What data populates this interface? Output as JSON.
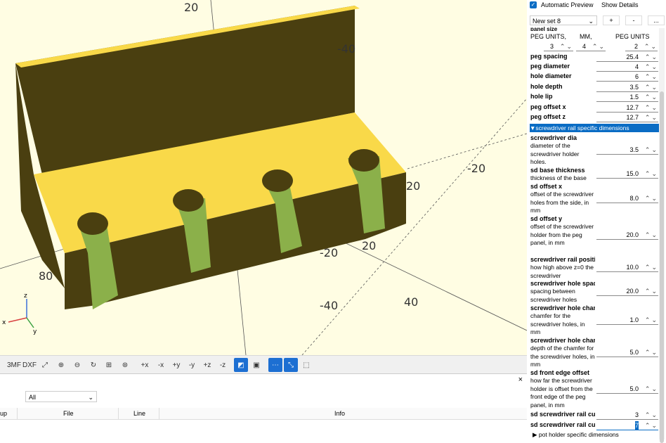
{
  "viewport": {
    "axis_labels": [
      "20",
      "-40",
      "-20",
      "20",
      "80",
      "40",
      "-40",
      "-20",
      "80"
    ],
    "gizmo": {
      "z": "z",
      "x": "x",
      "y": "y"
    }
  },
  "toolbar": {
    "buttons": [
      "3MF",
      "DXF",
      "⤢",
      "⊕",
      "⊖",
      "↻",
      "⊞",
      "⊛",
      "+x",
      "-x",
      "+y",
      "-y",
      "+z",
      "-z",
      "◩",
      "▣",
      "⋯",
      "⤡",
      "⬚"
    ]
  },
  "console": {
    "close": "×",
    "filter": "All",
    "columns": [
      "up",
      "File",
      "Line",
      "Info"
    ]
  },
  "panel": {
    "auto_preview": "Automatic Preview",
    "show_details": "Show Details",
    "preset": "New set 8",
    "plus": "+",
    "minus": "-",
    "more": "...",
    "panel_size_label": "panel size",
    "units": [
      "PEG UNITS,",
      "MM,",
      "PEG UNITS"
    ],
    "units_values": [
      "3",
      "4",
      "2"
    ],
    "params": [
      {
        "label": "peg spacing",
        "value": "25.4"
      },
      {
        "label": "peg diameter",
        "value": "4"
      },
      {
        "label": "hole diameter",
        "value": "6"
      },
      {
        "label": "hole depth",
        "value": "3.5"
      },
      {
        "label": "hole lip",
        "value": "1.5"
      },
      {
        "label": "peg offset x",
        "value": "12.7"
      },
      {
        "label": "peg offset z",
        "value": "12.7"
      }
    ],
    "section1": "screwdriver rail specific dimensions",
    "details": [
      {
        "label": "screwdriver dia",
        "desc": "diameter of the screwdriver holder holes.",
        "value": "3.5"
      },
      {
        "label": "sd base thickness",
        "desc": "thickness of the base",
        "value": "15.0"
      },
      {
        "label": "sd offset x",
        "desc": "offset of the screwdriver holes from the side, in mm",
        "value": "8.0"
      },
      {
        "label": "sd offset y",
        "desc": "offset of the screwdriver holder from the peg panel, in mm",
        "value": "20.0"
      },
      {
        "label": "screwdriver rail positio",
        "desc": "how high above z=0 the screwdriver",
        "value": "10.0"
      },
      {
        "label": "screwdriver hole spaci",
        "desc": "spacing between screwdriver holes",
        "value": "20.0"
      },
      {
        "label": "screwdriver hole cham",
        "desc": "chamfer for the screwdriver holes, in mm",
        "value": "1.0"
      },
      {
        "label": "screwdriver hole cham",
        "desc": "depth of the chamfer for the screwdriver holes, in mm",
        "value": "5.0"
      },
      {
        "label": "sd front edge offset",
        "desc": "how far the screwdriver holder is offset from the front edge of the peg panel, in mm",
        "value": "5.0"
      },
      {
        "label": "sd screwdriver rail cut",
        "desc": "",
        "value": "3"
      },
      {
        "label": "sd screwdriver rail cut",
        "desc": "",
        "value": "7"
      }
    ],
    "section2": "pot holder specific dimensions"
  },
  "colors": {
    "model_top": "#f9d949",
    "model_side": "#4a3f10",
    "hole": "#8bb04a",
    "accent": "#0a6cc4"
  }
}
